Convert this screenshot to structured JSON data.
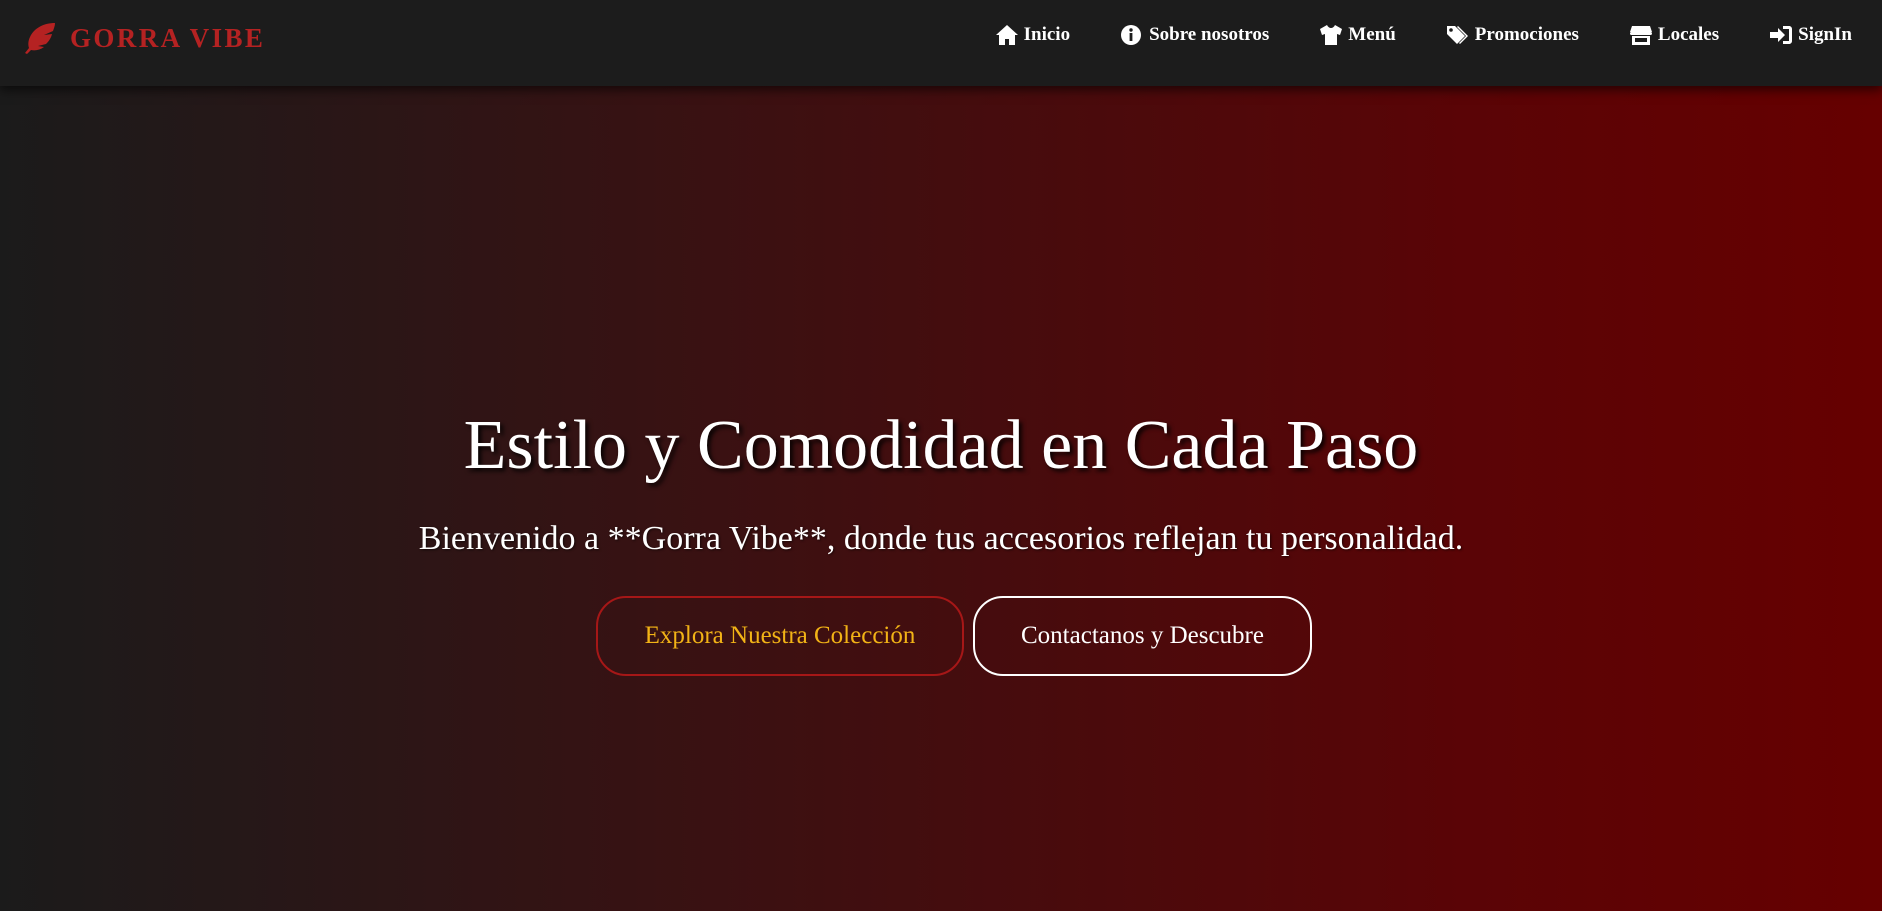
{
  "brand": {
    "name": "GORRA VIBE",
    "icon": "feather-icon",
    "color": "#b52222"
  },
  "nav": {
    "items": [
      {
        "label": "Inicio",
        "icon": "home-icon"
      },
      {
        "label": "Sobre nosotros",
        "icon": "info-circle-icon"
      },
      {
        "label": "Menú",
        "icon": "tshirt-icon"
      },
      {
        "label": "Promociones",
        "icon": "tags-icon"
      },
      {
        "label": "Locales",
        "icon": "store-icon"
      },
      {
        "label": "SignIn",
        "icon": "sign-in-icon"
      }
    ]
  },
  "hero": {
    "title": "Estilo y Comodidad en Cada Paso",
    "subtitle": "Bienvenido a **Gorra Vibe**, donde tus accesorios reflejan tu personalidad.",
    "primary_button": "Explora Nuestra Colección",
    "secondary_button": "Contactanos y Descubre"
  },
  "colors": {
    "navbar_bg": "#1c1c1c",
    "hero_gradient_start": "#1b1b1b",
    "hero_gradient_end": "#660000",
    "primary_button_text": "#f2b316",
    "primary_button_border": "#a61717",
    "secondary_button_border": "#ffffff"
  }
}
